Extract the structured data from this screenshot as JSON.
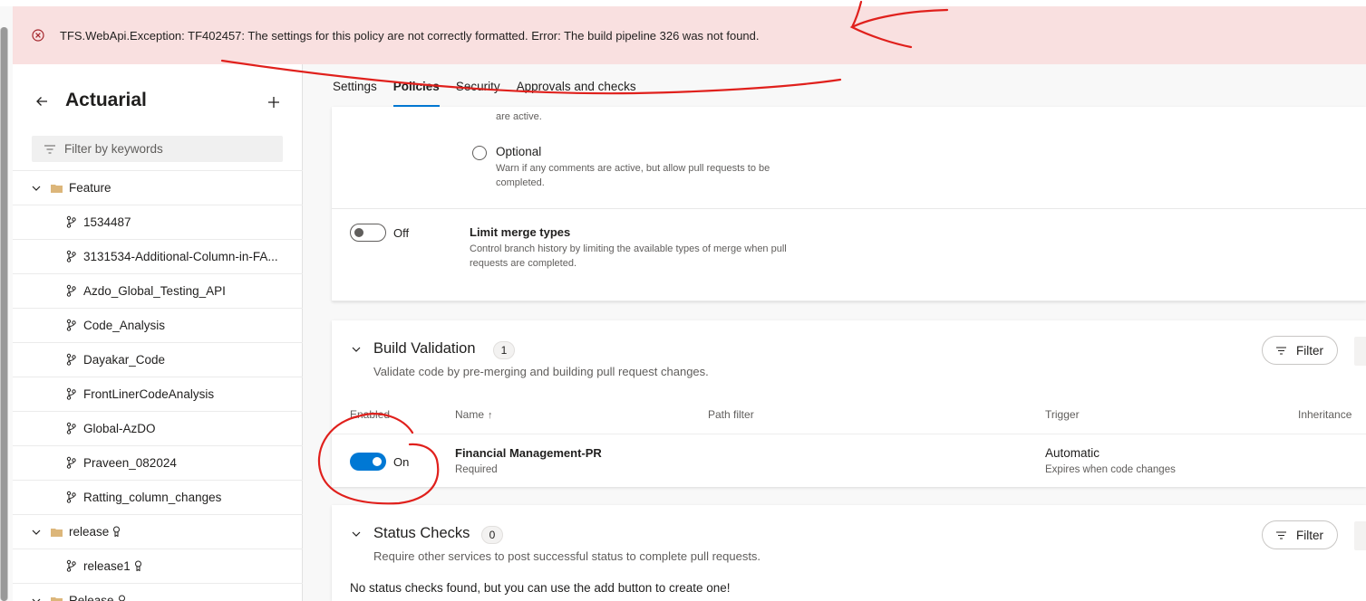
{
  "error_banner": {
    "message": "TFS.WebApi.Exception: TF402457: The settings for this policy are not correctly formatted. Error: The build pipeline 326 was not found."
  },
  "sidebar": {
    "title": "Actuarial",
    "filter_placeholder": "Filter by keywords",
    "tree": [
      {
        "type": "folder",
        "label": "Feature",
        "expanded": true
      },
      {
        "type": "branch",
        "label": "1534487"
      },
      {
        "type": "branch",
        "label": "3131534-Additional-Column-in-FA..."
      },
      {
        "type": "branch",
        "label": "Azdo_Global_Testing_API"
      },
      {
        "type": "branch",
        "label": "Code_Analysis"
      },
      {
        "type": "branch",
        "label": "Dayakar_Code"
      },
      {
        "type": "branch",
        "label": "FrontLinerCodeAnalysis"
      },
      {
        "type": "branch",
        "label": "Global-AzDO"
      },
      {
        "type": "branch",
        "label": "Praveen_082024"
      },
      {
        "type": "branch",
        "label": "Ratting_column_changes"
      },
      {
        "type": "folder",
        "label": "release",
        "locked": true,
        "expanded": true
      },
      {
        "type": "branch",
        "label": "release1",
        "locked": true
      },
      {
        "type": "folder",
        "label": "Release",
        "locked": true,
        "expanded": true
      }
    ]
  },
  "tabs": [
    {
      "label": "Settings",
      "active": false
    },
    {
      "label": "Policies",
      "active": true
    },
    {
      "label": "Security",
      "active": false
    },
    {
      "label": "Approvals and checks",
      "active": false
    }
  ],
  "comment_resolution": {
    "required_desc_tail": "are active.",
    "optional_label": "Optional",
    "optional_desc": "Warn if any comments are active, but allow pull requests to be completed."
  },
  "limit_merge": {
    "toggle_state": "Off",
    "title": "Limit merge types",
    "description": "Control branch history by limiting the available types of merge when pull requests are completed."
  },
  "build_validation": {
    "title": "Build Validation",
    "count": "1",
    "description": "Validate code by pre-merging and building pull request changes.",
    "filter_label": "Filter",
    "columns": [
      "Enabled",
      "Name",
      "Path filter",
      "Trigger",
      "Inheritance"
    ],
    "sort_arrow": "↑",
    "rows": [
      {
        "enabled_state": "On",
        "name": "Financial Management-PR",
        "name_sub": "Required",
        "trigger": "Automatic",
        "trigger_sub": "Expires when code changes"
      }
    ]
  },
  "status_checks": {
    "title": "Status Checks",
    "count": "0",
    "description": "Require other services to post successful status to complete pull requests.",
    "filter_label": "Filter",
    "empty_text": "No status checks found, but you can use the add button to create one!"
  },
  "colors": {
    "error_bg": "#f9e0e0",
    "accent": "#0078d4",
    "annotation": "#e0201c"
  }
}
